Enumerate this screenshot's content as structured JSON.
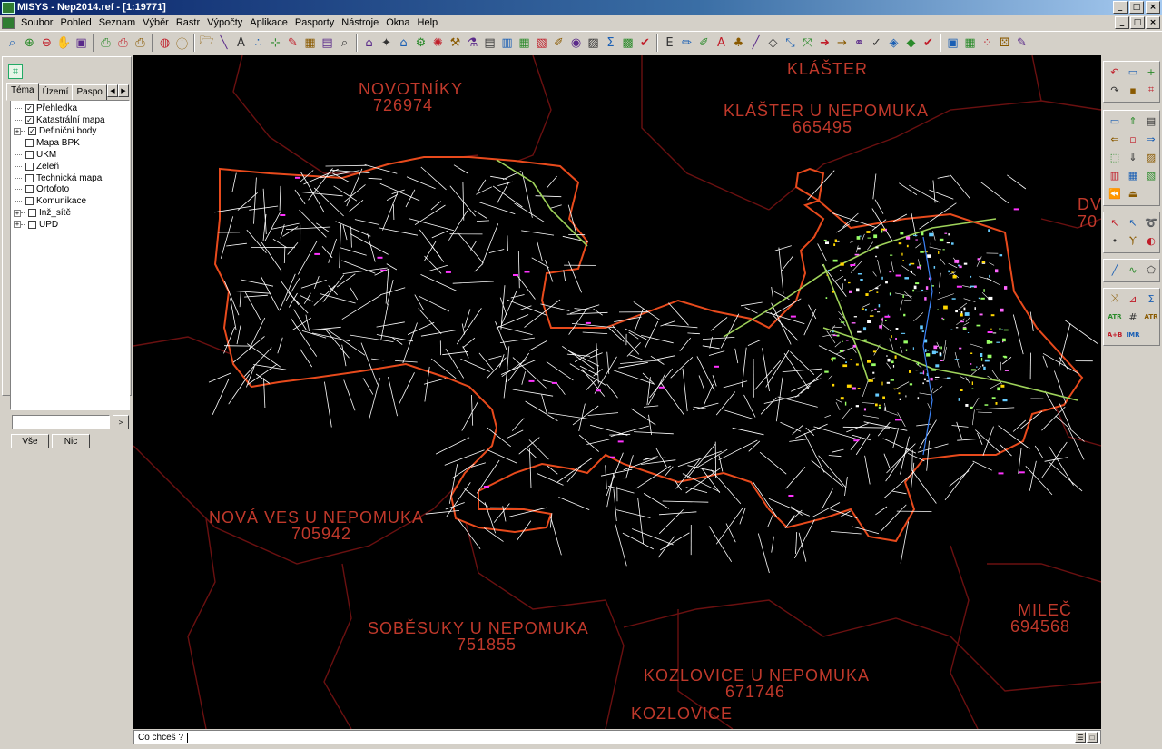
{
  "window": {
    "title": "MISYS - Nep2014.ref - [1:19771]",
    "buttons": [
      "_",
      "□",
      "×"
    ]
  },
  "menu": {
    "items": [
      "Soubor",
      "Pohled",
      "Seznam",
      "Výběr",
      "Rastr",
      "Výpočty",
      "Aplikace",
      "Pasporty",
      "Nástroje",
      "Okna",
      "Help"
    ],
    "mdi_buttons": [
      "_",
      "□",
      "×"
    ]
  },
  "toolbar": {
    "groups": [
      [
        {
          "icon": "zoom-window-icon",
          "glyph": "⌕"
        },
        {
          "icon": "zoom-in-icon",
          "glyph": "⊕"
        },
        {
          "icon": "zoom-out-icon",
          "glyph": "⊖"
        },
        {
          "icon": "pan-icon",
          "glyph": "✋"
        },
        {
          "icon": "redraw-icon",
          "glyph": "▣"
        }
      ],
      [
        {
          "icon": "print-icon",
          "glyph": "⎙"
        },
        {
          "icon": "print-preview-icon",
          "glyph": "⎙"
        },
        {
          "icon": "printer-setup-icon",
          "glyph": "⎙"
        }
      ],
      [
        {
          "icon": "globe-icon",
          "glyph": "◍"
        },
        {
          "icon": "info-icon",
          "glyph": "ⓘ"
        }
      ],
      [
        {
          "icon": "open-folder-icon",
          "glyph": "🗁"
        },
        {
          "icon": "line-icon",
          "glyph": "╲"
        },
        {
          "icon": "text-icon",
          "glyph": "A"
        },
        {
          "icon": "points-icon",
          "glyph": "∴"
        },
        {
          "icon": "point-add-icon",
          "glyph": "⊹"
        },
        {
          "icon": "edit-icon",
          "glyph": "✎"
        },
        {
          "icon": "fill-icon",
          "glyph": "▦"
        },
        {
          "icon": "layers-icon",
          "glyph": "▤"
        },
        {
          "icon": "search-icon",
          "glyph": "⌕"
        }
      ],
      [
        {
          "icon": "building-icon",
          "glyph": "⌂"
        },
        {
          "icon": "tool-2-icon",
          "glyph": "✦"
        },
        {
          "icon": "tool-3-icon",
          "glyph": "⌂"
        },
        {
          "icon": "tool-4-icon",
          "glyph": "⚙"
        },
        {
          "icon": "tool-5-icon",
          "glyph": "✺"
        },
        {
          "icon": "tool-6-icon",
          "glyph": "⚒"
        },
        {
          "icon": "tool-7-icon",
          "glyph": "⚗"
        },
        {
          "icon": "document-icon",
          "glyph": "▤"
        },
        {
          "icon": "tool-9-icon",
          "glyph": "▥"
        },
        {
          "icon": "tool-10-icon",
          "glyph": "▦"
        },
        {
          "icon": "tool-11-icon",
          "glyph": "▧"
        },
        {
          "icon": "tool-12-icon",
          "glyph": "✐"
        },
        {
          "icon": "tool-13-icon",
          "glyph": "◉"
        },
        {
          "icon": "tool-14-icon",
          "glyph": "▨"
        },
        {
          "icon": "sum-icon",
          "glyph": "Σ"
        },
        {
          "icon": "tool-16-icon",
          "glyph": "▩"
        },
        {
          "icon": "tool-17-icon",
          "glyph": "✔"
        }
      ],
      [
        {
          "icon": "tool-e-icon",
          "glyph": "E"
        },
        {
          "icon": "pencil-icon",
          "glyph": "✏"
        },
        {
          "icon": "red-pen-icon",
          "glyph": "✐"
        },
        {
          "icon": "text-a-icon",
          "glyph": "A"
        },
        {
          "icon": "tree-icon",
          "glyph": "♣"
        },
        {
          "icon": "diagonal-icon",
          "glyph": "╱"
        },
        {
          "icon": "eraser-icon",
          "glyph": "◇"
        },
        {
          "icon": "arrows-icon",
          "glyph": "⤡"
        },
        {
          "icon": "move-icon",
          "glyph": "⤧"
        },
        {
          "icon": "arrow-right-green-icon",
          "glyph": "➜"
        },
        {
          "icon": "arrow-right-icon",
          "glyph": "→"
        },
        {
          "icon": "nodes-icon",
          "glyph": "⚭"
        },
        {
          "icon": "fan-icon",
          "glyph": "✓"
        },
        {
          "icon": "shape-icon",
          "glyph": "◈"
        },
        {
          "icon": "shape-2-icon",
          "glyph": "◆"
        },
        {
          "icon": "checkmark-icon",
          "glyph": "✔"
        }
      ],
      [
        {
          "icon": "palette-icon",
          "glyph": "▣"
        },
        {
          "icon": "grid-colors-icon",
          "glyph": "▦"
        },
        {
          "icon": "dots-icon",
          "glyph": "⁘"
        },
        {
          "icon": "dice-icon",
          "glyph": "⚄"
        },
        {
          "icon": "brush-icon",
          "glyph": "✎"
        }
      ]
    ]
  },
  "left_panel": {
    "tabs": [
      {
        "label": "Téma",
        "active": true
      },
      {
        "label": "Území",
        "active": false
      },
      {
        "label": "Paspo",
        "active": false
      }
    ],
    "tree": [
      {
        "label": "Přehledka",
        "checked": true,
        "expandable": false
      },
      {
        "label": "Katastrální mapa",
        "checked": true,
        "expandable": false
      },
      {
        "label": "Definiční body",
        "checked": true,
        "expandable": true
      },
      {
        "label": "Mapa BPK",
        "checked": false,
        "expandable": false
      },
      {
        "label": "UKM",
        "checked": false,
        "expandable": false
      },
      {
        "label": "Zeleň",
        "checked": false,
        "expandable": false
      },
      {
        "label": "Technická mapa",
        "checked": false,
        "expandable": false
      },
      {
        "label": "Ortofoto",
        "checked": false,
        "expandable": false
      },
      {
        "label": "Komunikace",
        "checked": false,
        "expandable": false
      },
      {
        "label": "Inž_sítě",
        "checked": false,
        "expandable": true
      },
      {
        "label": "UPD",
        "checked": false,
        "expandable": true
      }
    ],
    "search_value": "",
    "all_button": "Vše",
    "none_button": "Nic"
  },
  "map": {
    "background": "#000000",
    "label_color": "#c0392b",
    "boundary_color": "#e84a1c",
    "labels": [
      {
        "id": "klaster",
        "text": "KLÁŠTER"
      },
      {
        "id": "novotniky",
        "text": "NOVOTNÍKY"
      },
      {
        "id": "novotniky-code",
        "text": "726974"
      },
      {
        "id": "klaster-u-nepomuka",
        "text": "KLÁŠTER U NEPOMUKA"
      },
      {
        "id": "klaster-u-nepomuka-code",
        "text": "665495"
      },
      {
        "id": "dv",
        "text": "DV"
      },
      {
        "id": "dv-code",
        "text": "70"
      },
      {
        "id": "nova-ves",
        "text": "NOVÁ VES U NEPOMUKA"
      },
      {
        "id": "nova-ves-code",
        "text": "705942"
      },
      {
        "id": "milec",
        "text": "MILEČ"
      },
      {
        "id": "milec-code",
        "text": "694568"
      },
      {
        "id": "sobesuky",
        "text": "SOBĚSUKY U NEPOMUKA"
      },
      {
        "id": "sobesuky-code",
        "text": "751855"
      },
      {
        "id": "kozlovice-u-nepomuka",
        "text": "KOZLOVICE U NEPOMUKA"
      },
      {
        "id": "kozlovice-code",
        "text": "671746"
      },
      {
        "id": "kozlovice",
        "text": "KOZLOVICE"
      }
    ]
  },
  "right_toolbar": {
    "buttons": [
      {
        "icon": "undo-icon",
        "glyph": "↶"
      },
      {
        "icon": "info-box-icon",
        "glyph": "▭"
      },
      {
        "icon": "crosshair-icon",
        "glyph": "+"
      },
      {
        "icon": "redo-icon",
        "glyph": "↷"
      },
      {
        "icon": "square-marker-icon",
        "glyph": "▪"
      },
      {
        "icon": "xy-icon",
        "glyph": "⌗"
      },
      {
        "icon": "window-select-icon",
        "glyph": "▭"
      },
      {
        "icon": "arrow-up-box-icon",
        "glyph": "⇑"
      },
      {
        "icon": "grid-box-icon",
        "glyph": "▤"
      },
      {
        "icon": "arrow-left-box-icon",
        "glyph": "⇐"
      },
      {
        "icon": "center-box-icon",
        "glyph": "▫"
      },
      {
        "icon": "arrow-right-box-icon",
        "glyph": "⇒"
      },
      {
        "icon": "dash-box-icon",
        "glyph": "⬚"
      },
      {
        "icon": "arrow-down-box-icon",
        "glyph": "⇓"
      },
      {
        "icon": "doc-box-icon",
        "glyph": "▨"
      },
      {
        "icon": "page-box-icon",
        "glyph": "▥"
      },
      {
        "icon": "green-box-icon",
        "glyph": "▦"
      },
      {
        "icon": "color-box-icon",
        "glyph": "▧"
      },
      {
        "icon": "rewind-icon",
        "glyph": "⏪"
      },
      {
        "icon": "eject-box-icon",
        "glyph": "⏏"
      },
      {
        "icon": "select-red-icon",
        "glyph": "↖"
      },
      {
        "icon": "select-arrow-icon",
        "glyph": "↖"
      },
      {
        "icon": "lasso-icon",
        "glyph": "➰"
      },
      {
        "icon": "point-select-icon",
        "glyph": "•"
      },
      {
        "icon": "fork-icon",
        "glyph": "Ⲩ"
      },
      {
        "icon": "settings-select-icon",
        "glyph": "◐"
      },
      {
        "icon": "line-draw-icon",
        "glyph": "╱"
      },
      {
        "icon": "curve-icon",
        "glyph": "∿"
      },
      {
        "icon": "polygon-icon",
        "glyph": "⬠"
      },
      {
        "icon": "transform-icon",
        "glyph": "⤨"
      },
      {
        "icon": "measure-icon",
        "glyph": "⊿"
      },
      {
        "icon": "sigma-icon",
        "glyph": "Σ"
      },
      {
        "icon": "atr-icon",
        "glyph": "ATR"
      },
      {
        "icon": "hash-icon",
        "glyph": "#"
      },
      {
        "icon": "attr-icon",
        "glyph": "ATR"
      },
      {
        "icon": "a-plus-b-icon",
        "glyph": "A+B"
      },
      {
        "icon": "imr-icon",
        "glyph": "IMR"
      }
    ]
  },
  "command_bar": {
    "prompt": "Co chceš ?",
    "value": ""
  }
}
